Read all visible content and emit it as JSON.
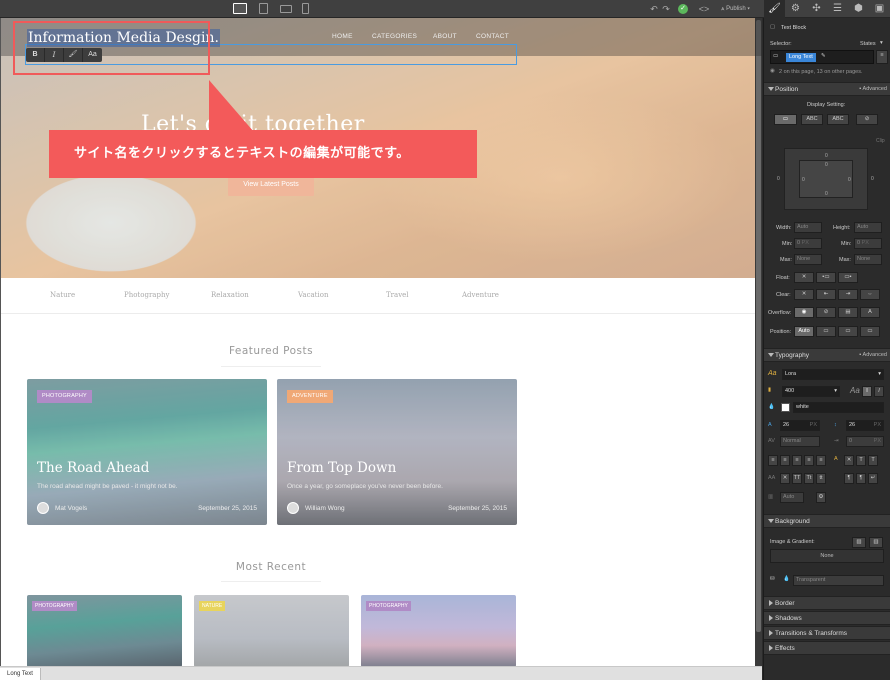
{
  "toolbar": {
    "publish_label": "Publish"
  },
  "site": {
    "name": "Information Media Desgin.",
    "nav": [
      "HOME",
      "CATEGORIES",
      "ABOUT",
      "CONTACT"
    ],
    "hero_title": "Let's do it together",
    "hero_button": "View Latest Posts",
    "categories": [
      "Nature",
      "Photography",
      "Relaxation",
      "Vacation",
      "Travel",
      "Adventure"
    ],
    "featured_title": "Featured Posts",
    "recent_title": "Most Recent",
    "featured": [
      {
        "badge": "PHOTOGRAPHY",
        "badge_color": "#b08bc6",
        "title": "The Road Ahead",
        "subtitle": "The road ahead might be paved - it might not be.",
        "author": "Mat Vogels",
        "date": "September 25, 2015"
      },
      {
        "badge": "ADVENTURE",
        "badge_color": "#f0a876",
        "title": "From Top Down",
        "subtitle": "Once a year, go someplace you've never been before.",
        "author": "William Wong",
        "date": "September 25, 2015"
      }
    ],
    "recent": [
      {
        "badge": "PHOTOGRAPHY",
        "badge_color": "#b08bc6"
      },
      {
        "badge": "NATURE",
        "badge_color": "#e8d45c"
      },
      {
        "badge": "PHOTOGRAPHY",
        "badge_color": "#b08bc6"
      }
    ]
  },
  "callout": {
    "text": "サイト名をクリックするとテキストの編集が可能です。",
    "color": "#f35a5a"
  },
  "richtext_toolbar": [
    "B",
    "I",
    "link",
    "Aa"
  ],
  "breadcrumb": "Long Text",
  "panel": {
    "element_type": "Text Block",
    "selector_label": "Selector:",
    "states_label": "States",
    "selector_value": "Long Text",
    "usage_info": "2 on this page, 13 on other pages.",
    "position": {
      "title": "Position",
      "advanced": "Advanced",
      "display_label": "Display Setting:",
      "display_options": [
        "",
        "ABC",
        "ABC",
        ""
      ],
      "box_values": {
        "margin_top": "0",
        "margin_left": "0",
        "margin_right": "0",
        "padding_top": "0",
        "padding_left": "0",
        "padding_right": "0",
        "padding_bottom": "0",
        "clip_label": "Clip"
      },
      "width_label": "Width:",
      "width_value": "Auto",
      "height_label": "Height:",
      "height_value": "Auto",
      "min_label": "Min:",
      "min_value": "0",
      "max_label": "Max:",
      "max_value": "None",
      "px": "PX",
      "float_label": "Float:",
      "clear_label": "Clear:",
      "overflow_label": "Overflow:",
      "position_label": "Position:",
      "position_value": "Auto"
    },
    "typography": {
      "title": "Typography",
      "advanced": "Advanced",
      "font": "Lora",
      "weight": "400",
      "color_name": "white",
      "size": "26",
      "line_height": "26",
      "px": "PX",
      "spacing_value": "Normal",
      "indent_value": "0",
      "columns_value": "Auto"
    },
    "background": {
      "title": "Background",
      "image_label": "Image & Gradient:",
      "image_value": "None",
      "color_value": "Transparent"
    },
    "sections": [
      "Border",
      "Shadows",
      "Transitions & Transforms",
      "Effects"
    ]
  }
}
